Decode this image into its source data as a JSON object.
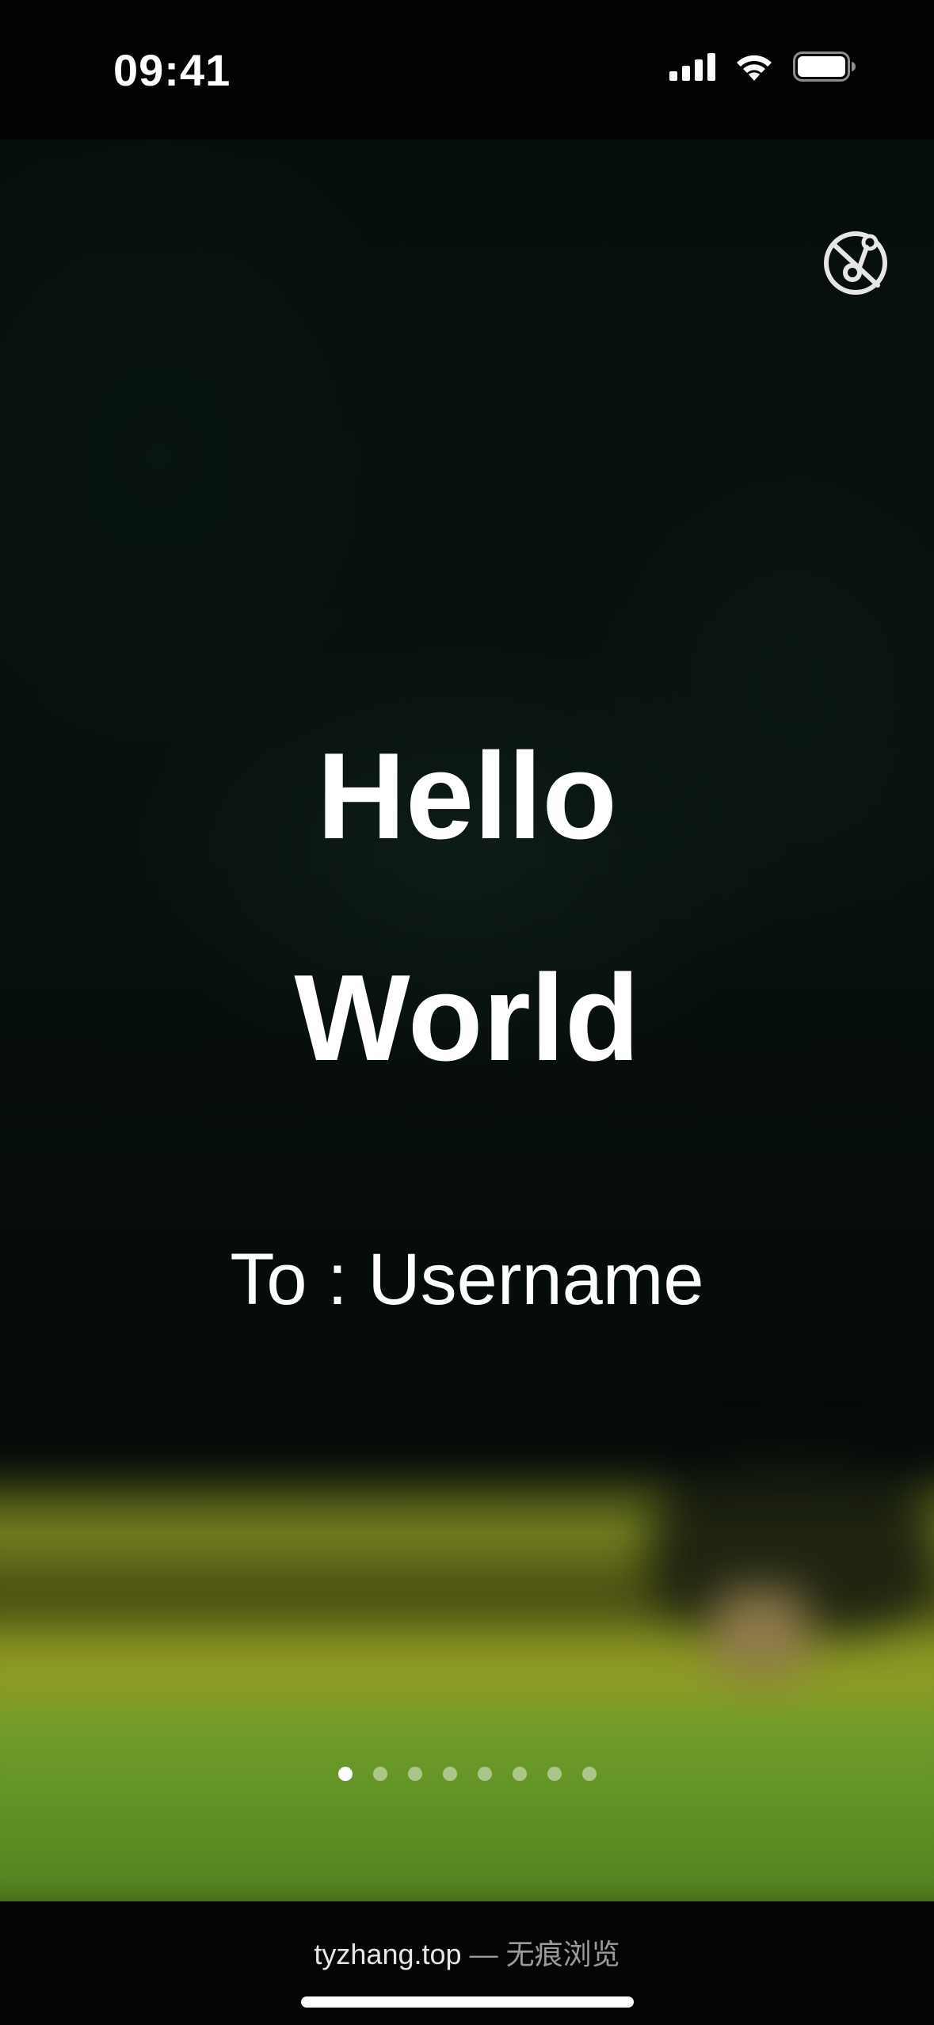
{
  "status_bar": {
    "time": "09:41",
    "icons": [
      "cellular-signal-icon",
      "wifi-icon",
      "battery-icon"
    ],
    "battery_level": 1.0
  },
  "top_button": {
    "icon": "music-off-icon"
  },
  "greeting": {
    "line1": "Hello",
    "line2": "World"
  },
  "recipient": {
    "text": "To : Username"
  },
  "pager": {
    "count": 8,
    "active_index": 0
  },
  "browser_bar": {
    "domain": "tyzhang.top",
    "separator": "—",
    "mode": "无痕浏览"
  },
  "colors": {
    "text": "#ffffff",
    "dot_inactive": "rgba(255,255,255,0.45)",
    "dot_active": "#ffffff"
  }
}
